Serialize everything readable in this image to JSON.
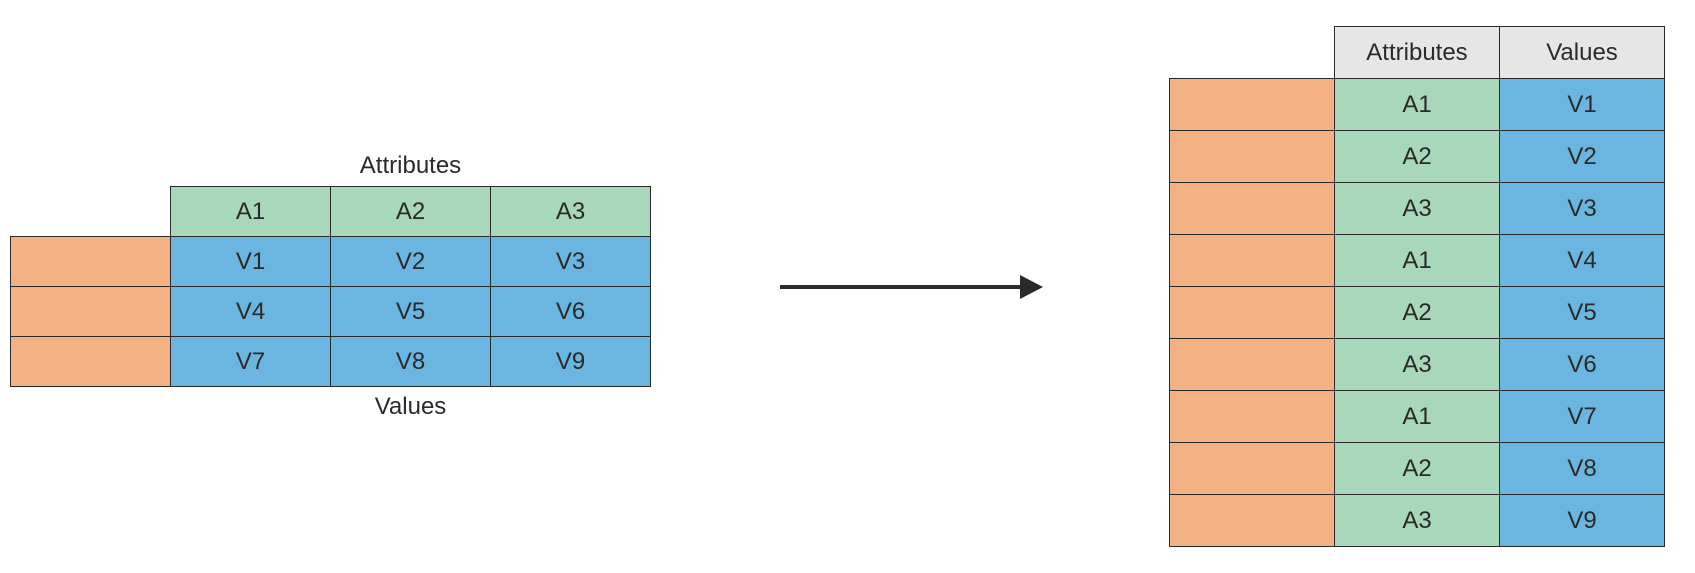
{
  "labels": {
    "attributes": "Attributes",
    "values": "Values"
  },
  "left": {
    "headers": [
      "A1",
      "A2",
      "A3"
    ],
    "rows": [
      [
        "V1",
        "V2",
        "V3"
      ],
      [
        "V4",
        "V5",
        "V6"
      ],
      [
        "V7",
        "V8",
        "V9"
      ]
    ]
  },
  "right": {
    "col_headers": [
      "Attributes",
      "Values"
    ],
    "rows": [
      {
        "attr": "A1",
        "val": "V1"
      },
      {
        "attr": "A2",
        "val": "V2"
      },
      {
        "attr": "A3",
        "val": "V3"
      },
      {
        "attr": "A1",
        "val": "V4"
      },
      {
        "attr": "A2",
        "val": "V5"
      },
      {
        "attr": "A3",
        "val": "V6"
      },
      {
        "attr": "A1",
        "val": "V7"
      },
      {
        "attr": "A2",
        "val": "V8"
      },
      {
        "attr": "A3",
        "val": "V9"
      }
    ]
  },
  "colors": {
    "orange": "#f4b183",
    "green": "#a8d7b9",
    "blue": "#6bb6e0",
    "grey": "#e6e6e6",
    "border": "#2a2a2a"
  },
  "chart_data": {
    "type": "table",
    "description": "Unpivot / melt operation: wide table with attribute columns A1-A3 and value rows is transformed into long table with Attributes and Values columns",
    "source_table": {
      "columns": [
        "A1",
        "A2",
        "A3"
      ],
      "data": [
        [
          "V1",
          "V2",
          "V3"
        ],
        [
          "V4",
          "V5",
          "V6"
        ],
        [
          "V7",
          "V8",
          "V9"
        ]
      ]
    },
    "result_table": {
      "columns": [
        "Attributes",
        "Values"
      ],
      "data": [
        [
          "A1",
          "V1"
        ],
        [
          "A2",
          "V2"
        ],
        [
          "A3",
          "V3"
        ],
        [
          "A1",
          "V4"
        ],
        [
          "A2",
          "V5"
        ],
        [
          "A3",
          "V6"
        ],
        [
          "A1",
          "V7"
        ],
        [
          "A2",
          "V8"
        ],
        [
          "A3",
          "V9"
        ]
      ]
    }
  }
}
